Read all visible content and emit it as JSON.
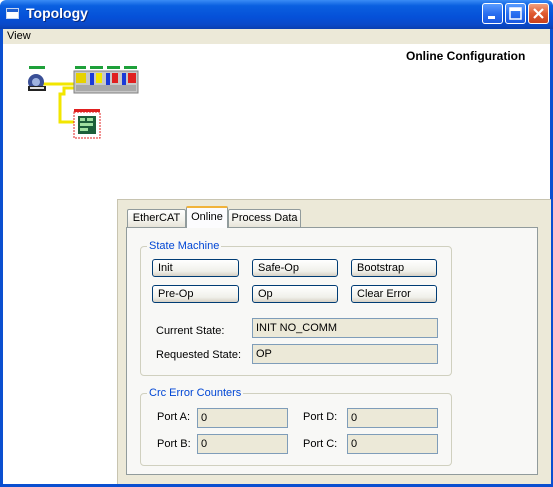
{
  "window": {
    "title": "Topology"
  },
  "menu": {
    "view": "View"
  },
  "canvas": {
    "title": "Online Configuration"
  },
  "tabs": {
    "ethercat": "EtherCAT",
    "online": "Online",
    "process_data": "Process Data",
    "active": "Online"
  },
  "state_machine": {
    "group_label": "State Machine",
    "buttons": {
      "init": "Init",
      "safe_op": "Safe-Op",
      "bootstrap": "Bootstrap",
      "pre_op": "Pre-Op",
      "op": "Op",
      "clear_error": "Clear Error"
    },
    "current_state_label": "Current State:",
    "current_state_value": "INIT NO_COMM",
    "requested_state_label": "Requested State:",
    "requested_state_value": "OP"
  },
  "crc": {
    "group_label": "Crc Error Counters",
    "port_a_label": "Port A:",
    "port_a_value": "0",
    "port_b_label": "Port B:",
    "port_b_value": "0",
    "port_c_label": "Port C:",
    "port_c_value": "0",
    "port_d_label": "Port D:",
    "port_d_value": "0"
  },
  "icons": [
    "master-icon",
    "terminal-block-icon",
    "device-icon"
  ],
  "colors": {
    "titlebar": "#0550d8",
    "accent_tab": "#f1b33a",
    "group_label": "#0046d5",
    "link_line": "#f2e600"
  }
}
